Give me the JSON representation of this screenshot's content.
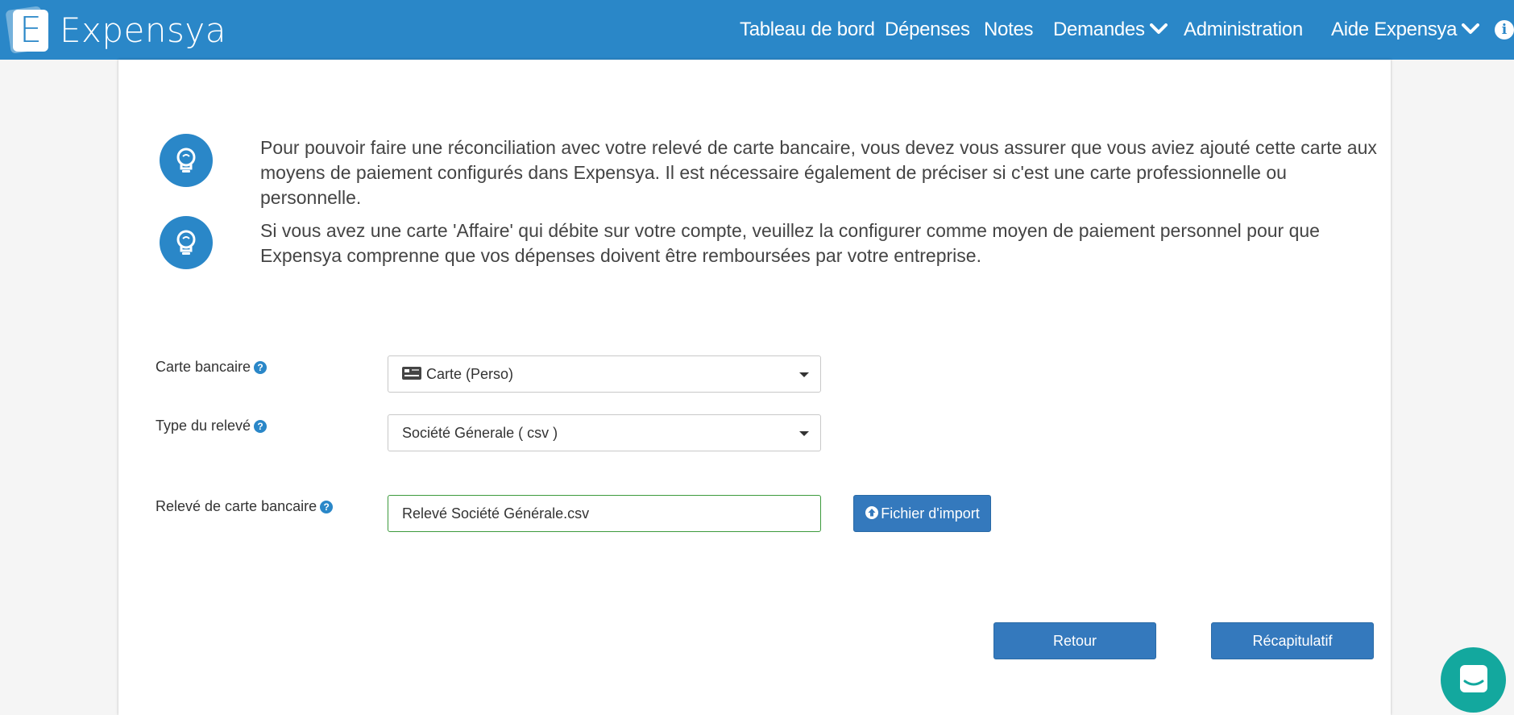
{
  "app": {
    "name": "Expensya",
    "logo_letter": "E"
  },
  "nav": {
    "items": [
      {
        "label": "Tableau de bord"
      },
      {
        "label": "Dépenses"
      },
      {
        "label": "Notes"
      },
      {
        "label": "Demandes",
        "has_dropdown": true
      },
      {
        "label": "Administration"
      },
      {
        "label": "Aide Expensya",
        "has_dropdown": true
      }
    ],
    "info_icon": "info-circle-icon",
    "info_glyph": "i"
  },
  "tips": [
    {
      "icon": "lightbulb-icon",
      "text": "Pour pouvoir faire une réconciliation avec votre relevé de carte bancaire, vous devez vous assurer que vous aviez ajouté cette carte aux moyens de paiement configurés dans Expensya. Il est nécessaire également de préciser si c'est une carte professionnelle ou personnelle."
    },
    {
      "icon": "lightbulb-icon",
      "text": "Si vous avez une carte 'Affaire' qui débite sur votre compte, veuillez la configurer comme moyen de paiement personnel pour que Expensya comprenne que vos dépenses doivent être remboursées par votre entreprise."
    }
  ],
  "form": {
    "card": {
      "label": "Carte bancaire",
      "value": "Carte (Perso)",
      "icon": "credit-card-icon"
    },
    "statement_type": {
      "label": "Type du relevé",
      "value": "Société Génerale ( csv )"
    },
    "statement_file": {
      "label": "Relevé de carte bancaire",
      "value": "Relevé Société Générale.csv"
    },
    "help_glyph": "?",
    "import_button": "Fichier d'import"
  },
  "actions": {
    "back": "Retour",
    "summary": "Récapitulatif"
  },
  "colors": {
    "primary": "#2a87c8",
    "button": "#3479bd",
    "valid_border": "#3c9a3c",
    "chat": "#13a89e"
  }
}
